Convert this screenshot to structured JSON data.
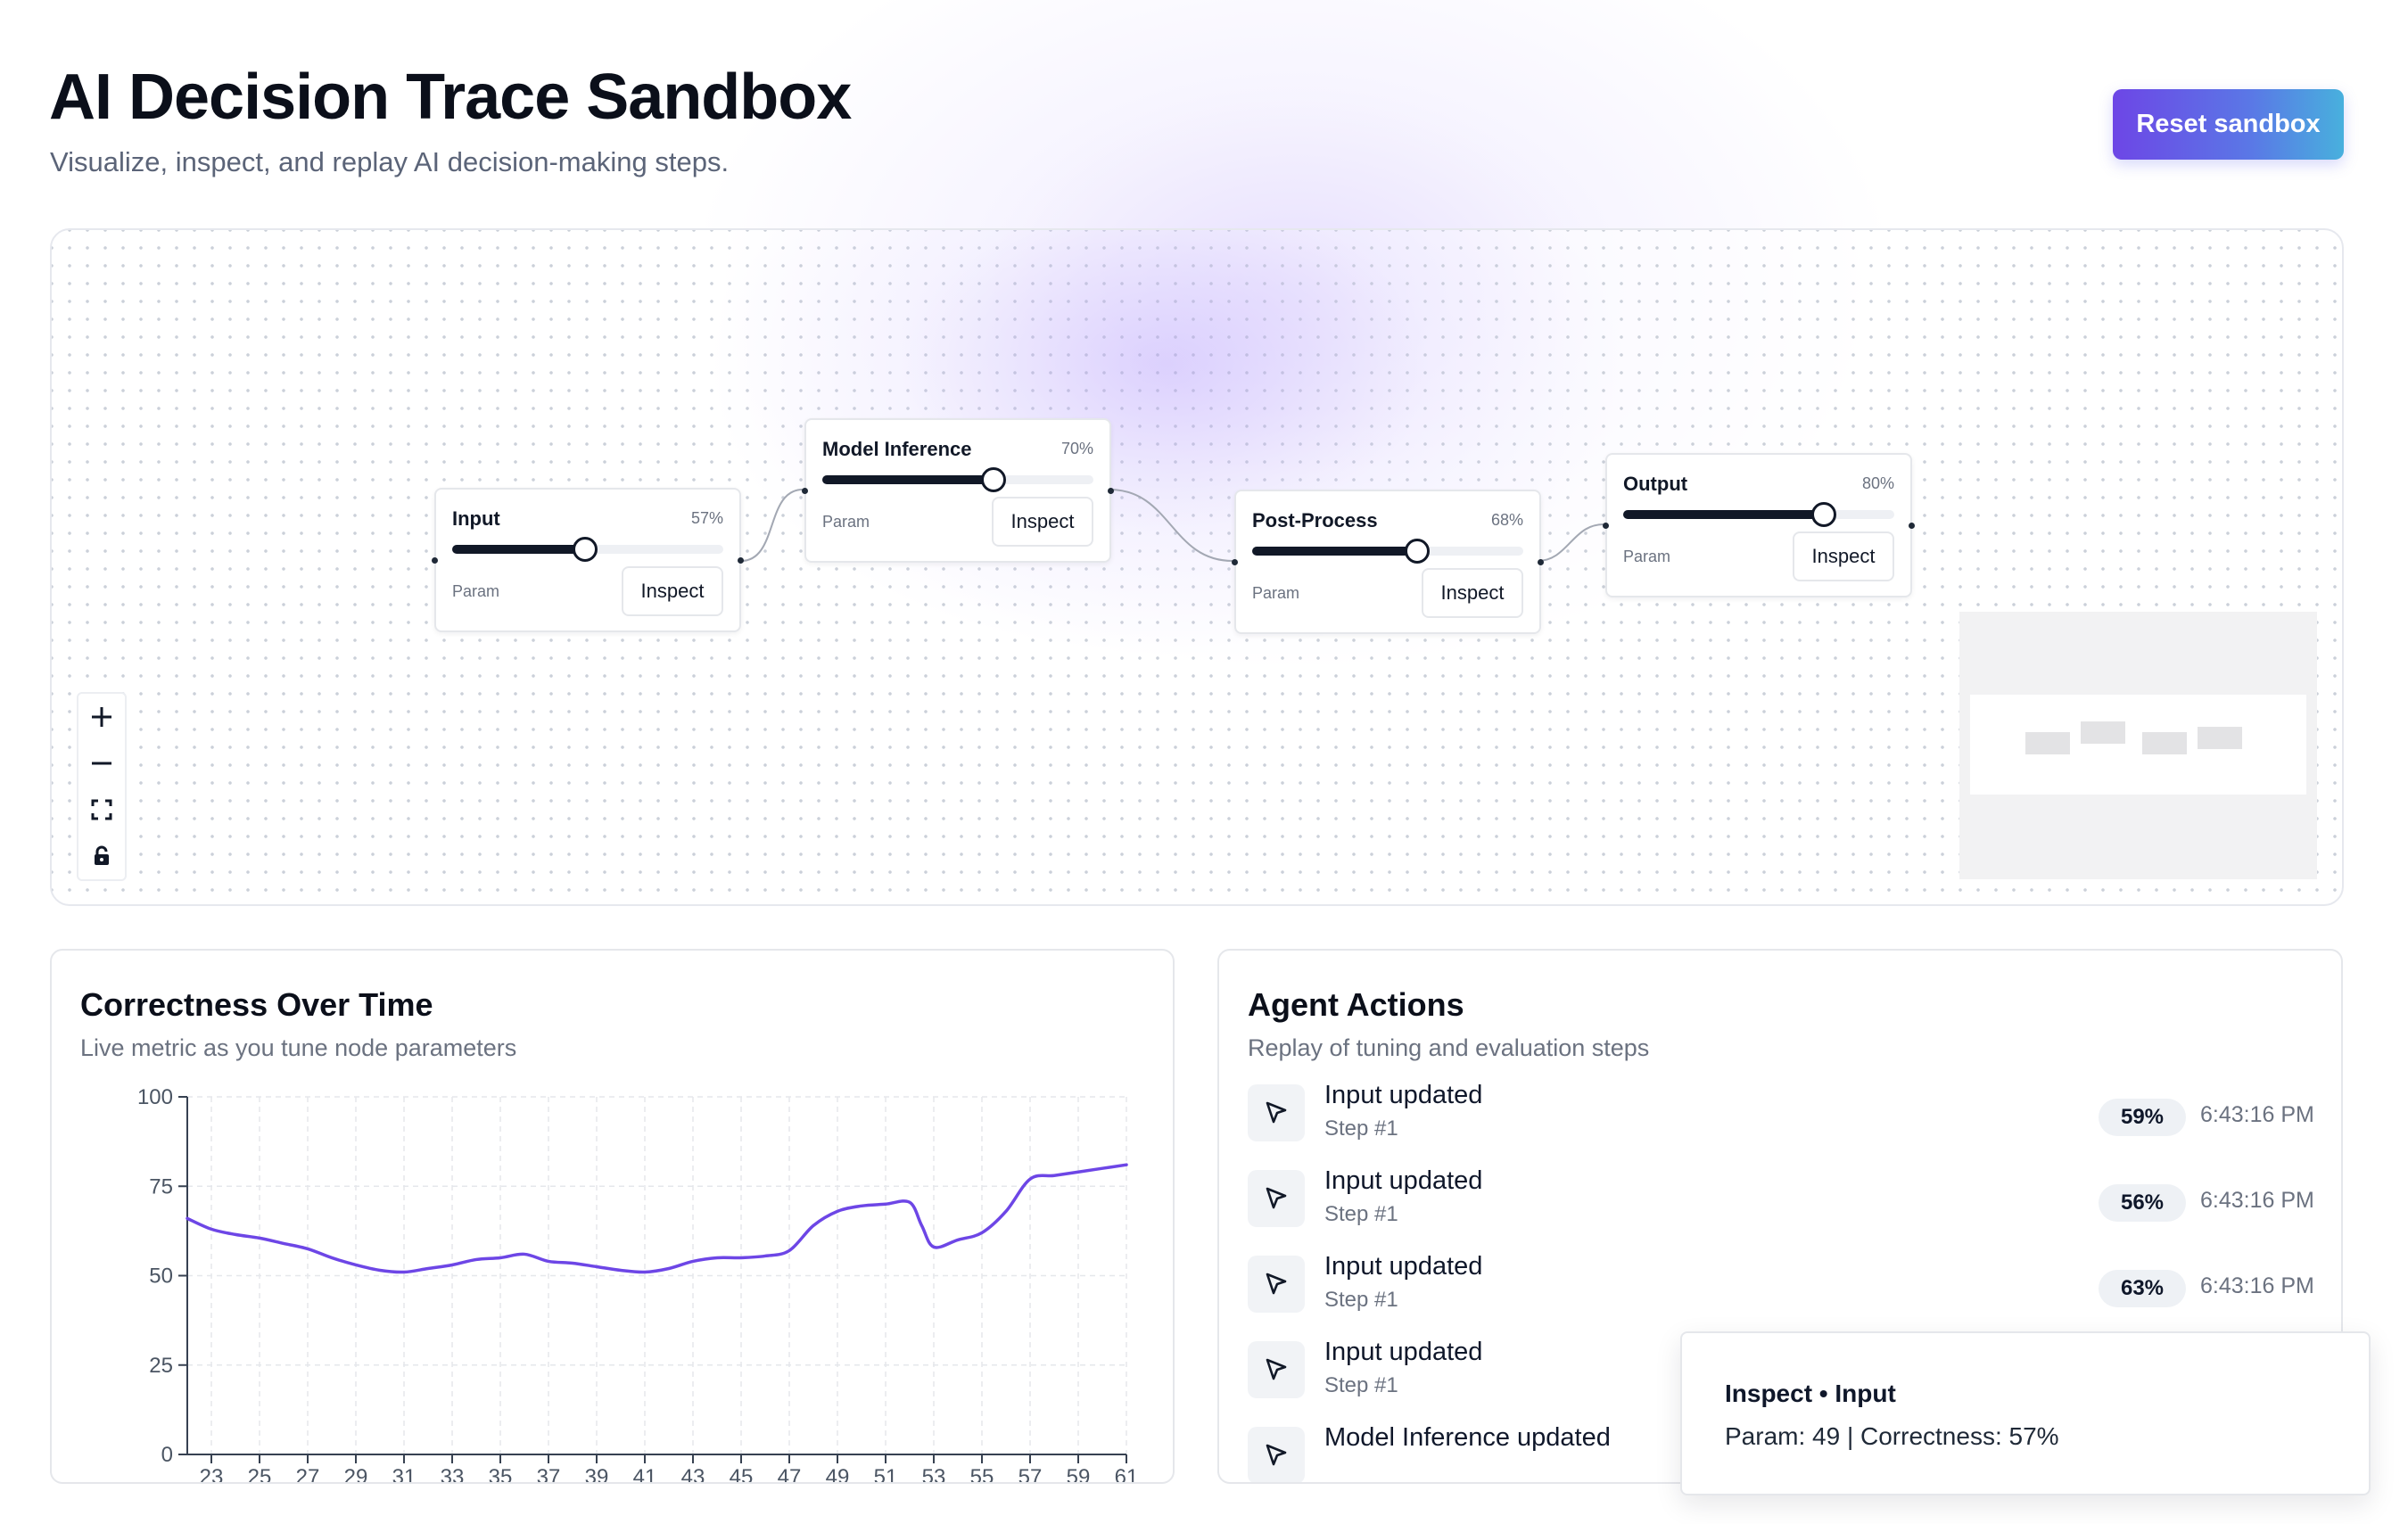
{
  "header": {
    "title": "AI Decision Trace Sandbox",
    "subtitle": "Visualize, inspect, and replay AI decision-making steps.",
    "reset_label": "Reset sandbox"
  },
  "flow": {
    "nodes": [
      {
        "id": "input",
        "title": "Input",
        "percent_label": "57%",
        "param_value": 0.49,
        "param_label": "Param",
        "inspect_label": "Inspect"
      },
      {
        "id": "model-inference",
        "title": "Model Inference",
        "percent_label": "70%",
        "param_value": 0.63,
        "param_label": "Param",
        "inspect_label": "Inspect"
      },
      {
        "id": "post-process",
        "title": "Post-Process",
        "percent_label": "68%",
        "param_value": 0.61,
        "param_label": "Param",
        "inspect_label": "Inspect"
      },
      {
        "id": "output",
        "title": "Output",
        "percent_label": "80%",
        "param_value": 0.74,
        "param_label": "Param",
        "inspect_label": "Inspect"
      }
    ],
    "controls": [
      {
        "name": "zoom-in-icon"
      },
      {
        "name": "zoom-out-icon"
      },
      {
        "name": "fit-view-icon"
      },
      {
        "name": "lock-icon"
      }
    ]
  },
  "correctness_panel": {
    "title": "Correctness Over Time",
    "subtitle": "Live metric as you tune node parameters"
  },
  "chart_data": {
    "type": "line",
    "title": "Correctness Over Time",
    "xlabel": "",
    "ylabel": "",
    "xlim": [
      22,
      61
    ],
    "ylim": [
      0,
      100
    ],
    "x_ticks": [
      23,
      25,
      27,
      29,
      31,
      33,
      35,
      37,
      39,
      41,
      43,
      45,
      47,
      49,
      51,
      53,
      55,
      57,
      59,
      61
    ],
    "y_ticks": [
      0,
      25,
      50,
      75,
      100
    ],
    "grid": true,
    "line_color": "#6d46e6",
    "series": [
      {
        "x": [
          22,
          23,
          24,
          25,
          26,
          27,
          28,
          29,
          30,
          31,
          32,
          33,
          34,
          35,
          36,
          37,
          38,
          39,
          40,
          41,
          42,
          43,
          44,
          45,
          46,
          47,
          48,
          49,
          50,
          51,
          52,
          52.5,
          53,
          54,
          55,
          56,
          57,
          58,
          59,
          60,
          61
        ],
        "y": [
          66,
          63,
          61.5,
          60.5,
          59,
          57.5,
          55,
          53,
          51.5,
          51,
          52,
          53,
          54.5,
          55,
          56,
          54,
          53.5,
          52.5,
          51.5,
          51,
          52,
          54,
          55,
          55,
          55.5,
          57,
          64,
          68,
          69.5,
          70,
          70.5,
          64,
          58,
          60,
          62,
          68,
          77,
          78,
          79,
          80,
          81
        ]
      }
    ]
  },
  "actions_panel": {
    "title": "Agent Actions",
    "subtitle": "Replay of tuning and evaluation steps",
    "items": [
      {
        "title": "Input updated",
        "step": "Step #1",
        "badge": "59%",
        "time": "6:43:16 PM"
      },
      {
        "title": "Input updated",
        "step": "Step #1",
        "badge": "56%",
        "time": "6:43:16 PM"
      },
      {
        "title": "Input updated",
        "step": "Step #1",
        "badge": "63%",
        "time": "6:43:16 PM"
      },
      {
        "title": "Input updated",
        "step": "Step #1",
        "badge": "",
        "time": ""
      },
      {
        "title": "Model Inference updated",
        "step": "",
        "badge": "",
        "time": ""
      }
    ]
  },
  "tooltip": {
    "title": "Inspect • Input",
    "body": "Param: 49 | Correctness: 57%"
  },
  "colors": {
    "accent": "#6d46e6",
    "accent_end": "#48b0dd",
    "text": "#0b0f1a",
    "muted": "#6b7280"
  }
}
